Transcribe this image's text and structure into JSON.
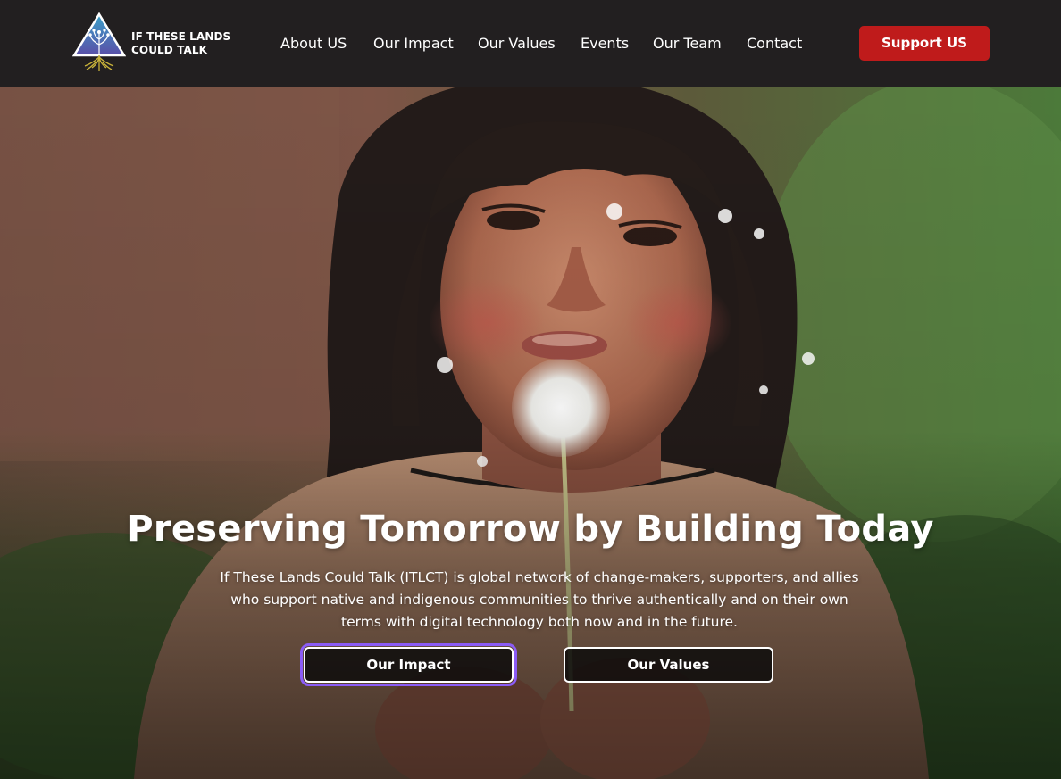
{
  "header": {
    "logo": {
      "line1": "IF THESE LANDS",
      "line2": "COULD TALK",
      "icon": "triangle-tree-logo-icon"
    },
    "nav": [
      {
        "label": "About US"
      },
      {
        "label": "Our Impact"
      },
      {
        "label": "Our Values"
      },
      {
        "label": "Events"
      },
      {
        "label": "Our Team"
      },
      {
        "label": "Contact"
      }
    ],
    "support_label": "Support US"
  },
  "hero": {
    "headline": "Preserving Tomorrow by Building Today",
    "lead": "If These Lands Could Talk (ITLCT) is global network of change-makers, supporters, and allies who support native and indigenous communities to thrive authentically and on their own terms with digital technology both now and in the future.",
    "buttons": {
      "impact": "Our Impact",
      "values": "Our Values"
    },
    "photo": "girl-blowing-dandelion-photo"
  },
  "colors": {
    "header_bg": "#221f20",
    "support_button": "#bf1b1b",
    "focus_outline": "#8b5cf6",
    "text": "#ffffff"
  }
}
